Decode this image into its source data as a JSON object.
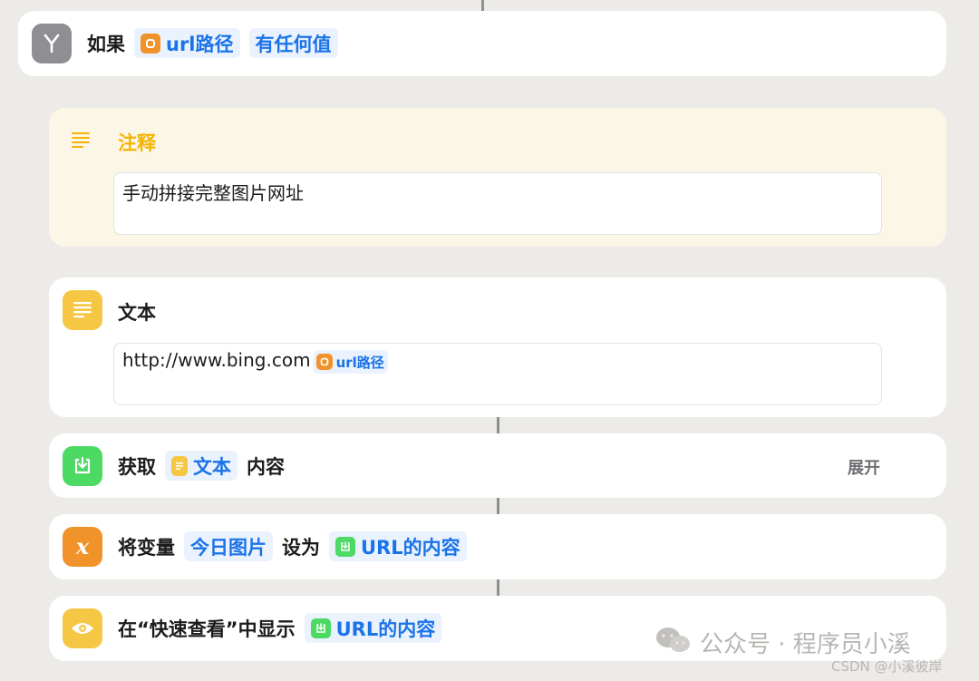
{
  "if_action": {
    "keyword": "如果",
    "variable": "url路径",
    "condition": "有任何值",
    "icon": "branch-icon",
    "icon_color": "#8e8e93"
  },
  "comment_action": {
    "title": "注释",
    "text": "手动拼接完整图片网址",
    "icon": "lines-icon",
    "accent": "#f5b400"
  },
  "text_action": {
    "title": "文本",
    "prefix_text": "http://www.bing.com",
    "variable": "url路径",
    "icon": "text-doc-icon",
    "icon_color": "#f6c744"
  },
  "get_action": {
    "label": "获取",
    "variable": "文本",
    "suffix": "内容",
    "expand_label": "展开",
    "icon": "download-icon",
    "icon_color": "#4cd964"
  },
  "setvar_action": {
    "label": "将变量",
    "var_name": "今日图片",
    "middle": "设为",
    "value": "URL的内容",
    "icon": "variable-x-icon",
    "icon_color": "#f0932b"
  },
  "quicklook_action": {
    "label": "在“快速查看”中显示",
    "value": "URL的内容",
    "icon": "eye-icon",
    "icon_color": "#f6c744"
  },
  "watermarks": {
    "wechat": "公众号 · 程序员小溪",
    "csdn": "CSDN @小溪彼岸"
  },
  "colors": {
    "token_bg": "#eaf2fd",
    "token_text": "#1a73e8",
    "variable_orange": "#f0932b"
  }
}
